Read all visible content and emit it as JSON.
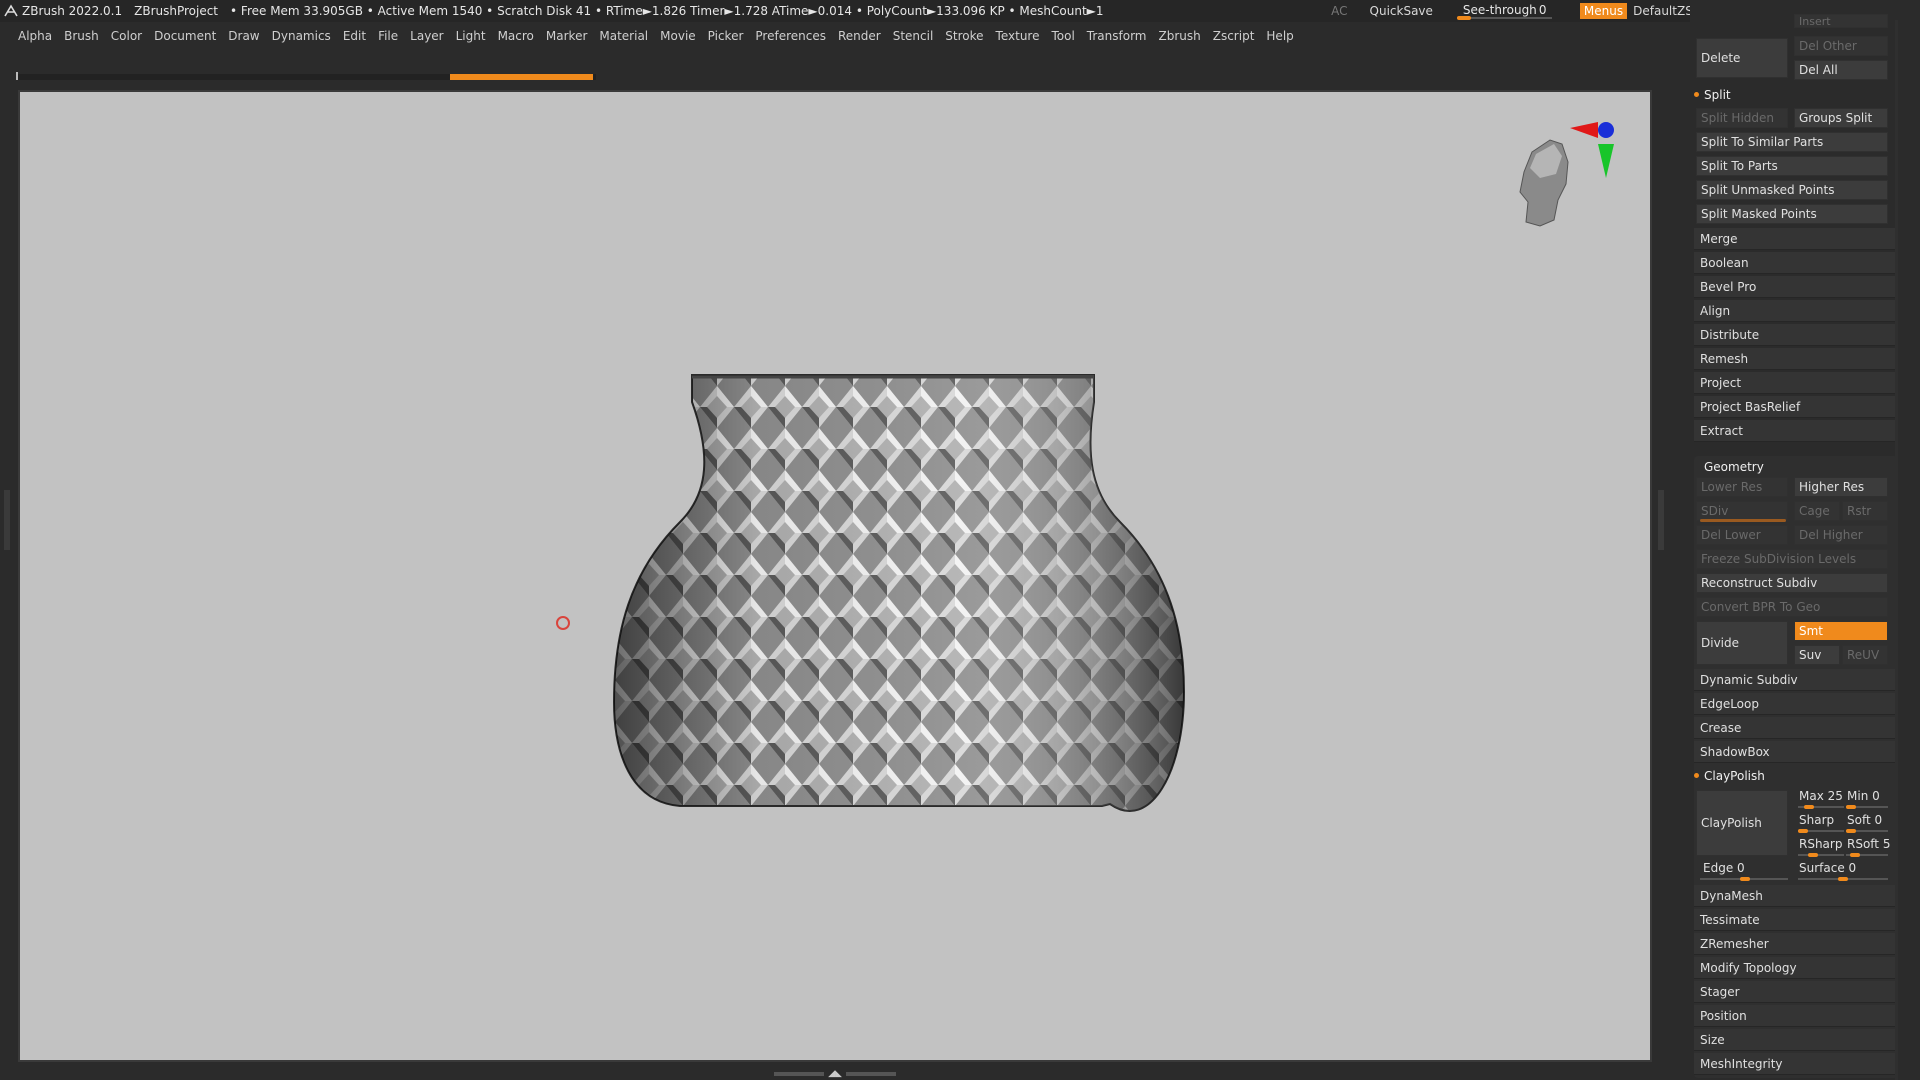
{
  "titlebar": {
    "app": "ZBrush 2022.0.1",
    "project": "ZBrushProject",
    "stats": "• Free Mem 33.905GB • Active Mem 1540 • Scratch Disk 41 • RTime►1.826 Timer►1.728 ATime►0.014 • PolyCount►133.096 KP • MeshCount►1",
    "ac": "AC",
    "quicksave": "QuickSave",
    "seethrough_label": "See-through",
    "seethrough_value": "0",
    "menus": "Menus",
    "script": "DefaultZScript"
  },
  "menubar": [
    "Alpha",
    "Brush",
    "Color",
    "Document",
    "Draw",
    "Dynamics",
    "Edit",
    "File",
    "Layer",
    "Light",
    "Macro",
    "Marker",
    "Material",
    "Movie",
    "Picker",
    "Preferences",
    "Render",
    "Stencil",
    "Stroke",
    "Texture",
    "Tool",
    "Transform",
    "Zbrush",
    "Zscript",
    "Help"
  ],
  "panel": {
    "top_partial": "Insert",
    "delete": "Delete",
    "del_other": "Del Other",
    "del_all": "Del All",
    "split_header": "Split",
    "split_hidden": "Split Hidden",
    "groups_split": "Groups Split",
    "split_similar": "Split To Similar Parts",
    "split_parts": "Split To Parts",
    "split_unmasked": "Split Unmasked Points",
    "split_masked": "Split Masked Points",
    "subtool_items": [
      "Merge",
      "Boolean",
      "Bevel Pro",
      "Align",
      "Distribute",
      "Remesh",
      "Project",
      "Project BasRelief",
      "Extract"
    ],
    "geometry_header": "Geometry",
    "lower_res": "Lower Res",
    "higher_res": "Higher Res",
    "sdiv": "SDiv",
    "cage": "Cage",
    "rstr": "Rstr",
    "del_lower": "Del Lower",
    "del_higher": "Del Higher",
    "freeze": "Freeze SubDivision Levels",
    "reconstruct": "Reconstruct Subdiv",
    "convert_bpr": "Convert BPR To Geo",
    "divide": "Divide",
    "smt": "Smt",
    "suv": "Suv",
    "reuv": "ReUV",
    "geo_items_1": [
      "Dynamic Subdiv",
      "EdgeLoop",
      "Crease",
      "ShadowBox"
    ],
    "claypolish_header": "ClayPolish",
    "claypolish_btn": "ClayPolish",
    "max_label": "Max",
    "max_value": "25",
    "min_label": "Min",
    "min_value": "0",
    "sharp_label": "Sharp",
    "soft_label": "Soft",
    "soft_value": "0",
    "rsharp_label": "RSharp",
    "rsoft_label": "RSoft",
    "rsoft_value": "5",
    "edge_label": "Edge",
    "edge_value": "0",
    "surface_label": "Surface",
    "surface_value": "0",
    "geo_items_2": [
      "DynaMesh",
      "Tessimate",
      "ZRemesher",
      "Modify Topology",
      "Stager",
      "Position",
      "Size",
      "MeshIntegrity"
    ]
  },
  "colors": {
    "accent": "#f08a1c",
    "canvas": "#c2c2c2",
    "bg": "#2b2b2b"
  }
}
